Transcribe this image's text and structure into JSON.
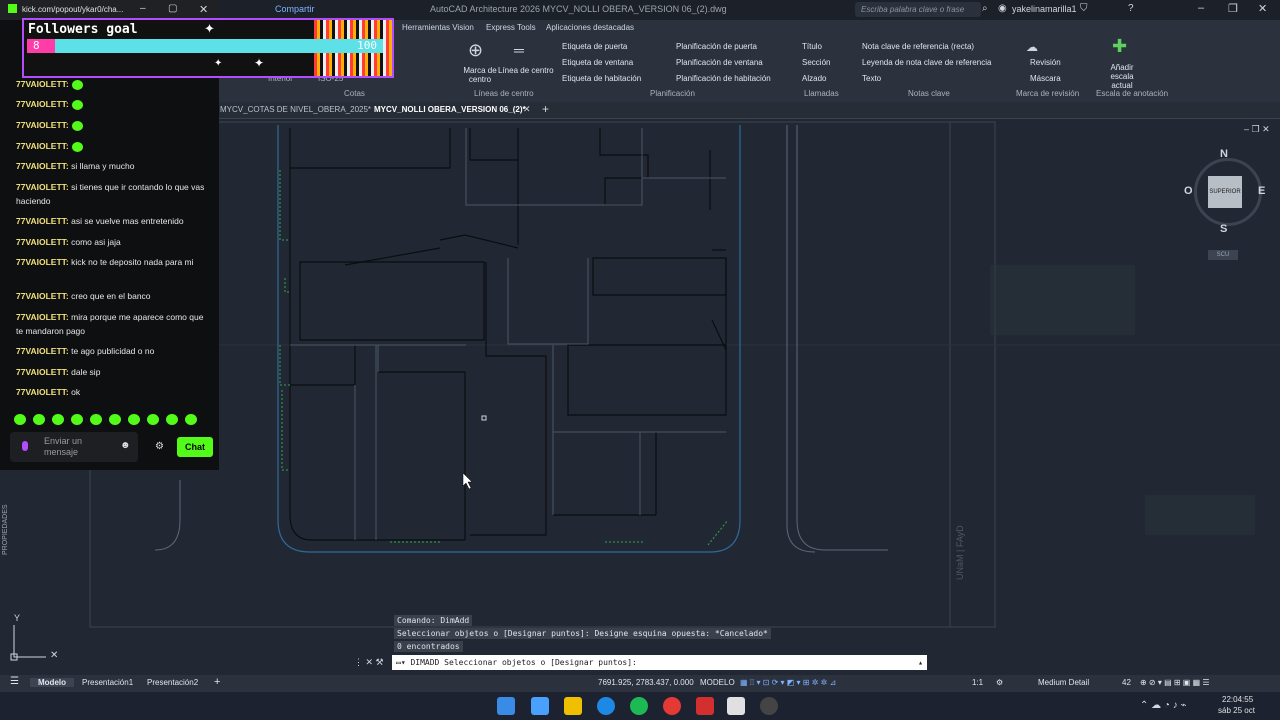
{
  "titlebar": {
    "title": "AutoCAD Architecture 2026   MYCV_NOLLI OBERA_VERSION 06_(2).dwg",
    "share": "Compartir",
    "search_placeholder": "Escriba palabra clave o frase",
    "user": "yakelinamarilla1"
  },
  "ribbon": {
    "tabs": [
      "Herramientas Vision",
      "Express Tools",
      "Aplicaciones destacadas"
    ],
    "items": {
      "marca_centro": "Marca de centro",
      "linea_centro": "Línea de centro",
      "etiqueta_puerta": "Etiqueta de puerta",
      "etiqueta_ventana": "Etiqueta de ventana",
      "etiqueta_habitacion": "Etiqueta de habitación",
      "plan_puerta": "Planificación de puerta",
      "plan_ventana": "Planificación de ventana",
      "plan_habitacion": "Planificación de habitación",
      "titulo": "Título",
      "seccion": "Sección",
      "alzado": "Alzado",
      "nota_clave": "Nota clave de referencia (recta)",
      "leyenda_nota": "Leyenda de nota clave de referencia",
      "texto": "Texto",
      "revision": "Revisión",
      "mascara": "Máscara",
      "anadir_escala": "Añadir escala actual",
      "interior": "Interior",
      "iso": "ISO-25"
    },
    "groups": {
      "cotas": "Cotas",
      "lineas_centro": "Líneas de centro",
      "planificacion": "Planificación",
      "llamadas": "Llamadas",
      "notas_clave": "Notas clave",
      "marca_revision": "Marca de revisión",
      "escala_anotacion": "Escala de anotación"
    }
  },
  "doctabs": [
    "MYCV_COTAS DE NIVEL_OBERA_2025*",
    "MYCV_NOLLI OBERA_VERSION 06_(2)*"
  ],
  "viewcube": {
    "n": "N",
    "s": "S",
    "e": "E",
    "o": "O",
    "face": "SUPERIOR",
    "ucs": "SCU"
  },
  "drawing_labels": {
    "unam": "UNaM | FAyD",
    "propiedades": "PROPIEDADES"
  },
  "command": {
    "history": [
      "Comando: DimAdd",
      "Seleccionar objetos o [Designar puntos]: Designe esquina opuesta: *Cancelado*",
      "0 encontrados"
    ],
    "prompt": "DIMADD Seleccionar objetos o [Designar puntos]:"
  },
  "statusbar": {
    "tabs": [
      "Modelo",
      "Presentación1",
      "Presentación2"
    ],
    "coords": "7691.925, 2783.437, 0.000",
    "mode": "MODELO",
    "scale": "1:1",
    "detail": "Medium Detail",
    "num": "42"
  },
  "taskbar": {
    "time": "22:04:55",
    "date": "sáb 25 oct"
  },
  "chat": {
    "url": "kick.com/popout/ykar0/cha...",
    "goal_title": "Followers goal",
    "goal_current": "8",
    "goal_target": "100",
    "goal_progress": 0.08,
    "messages": [
      {
        "user": "77VAIOLETT:",
        "text": ""
      },
      {
        "user": "77VAIOLETT:",
        "text": ""
      },
      {
        "user": "77VAIOLETT:",
        "text": ""
      },
      {
        "user": "77VAIOLETT:",
        "text": ""
      },
      {
        "user": "77VAIOLETT:",
        "text": "si llama y mucho"
      },
      {
        "user": "77VAIOLETT:",
        "text": "si tienes que ir contando lo que vas haciendo"
      },
      {
        "user": "77VAIOLETT:",
        "text": "asi se vuelve mas entretenido"
      },
      {
        "user": "77VAIOLETT:",
        "text": "como asi jaja"
      },
      {
        "user": "77VAIOLETT:",
        "text": "kick no te deposito nada para mi"
      },
      {
        "user": "77VAIOLETT:",
        "text": "creo que en el banco"
      },
      {
        "user": "77VAIOLETT:",
        "text": "mira porque me aparece como que te mandaron pago"
      },
      {
        "user": "77VAIOLETT:",
        "text": "te ago publicidad o no"
      },
      {
        "user": "77VAIOLETT:",
        "text": "dale sip"
      },
      {
        "user": "77VAIOLETT:",
        "text": "ok"
      }
    ],
    "input_placeholder": "Enviar un mensaje",
    "send_label": "Chat"
  }
}
